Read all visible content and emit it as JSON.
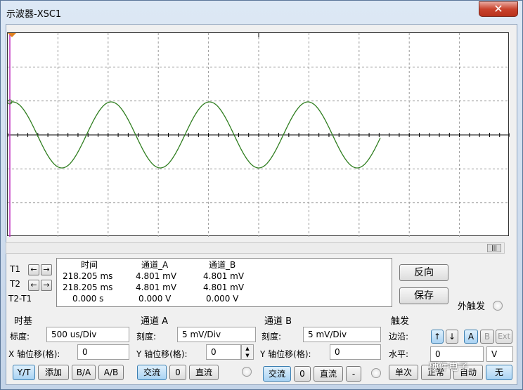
{
  "window": {
    "title": "示波器-XSC1",
    "close_glyph": "✕"
  },
  "scope": {
    "trace_color": "#2e7d1e",
    "cursor_color": "#c030c0",
    "grid_color": "#9a9a9a"
  },
  "cursors": {
    "t1_label": "T1",
    "t2_label": "T2",
    "t2t1_label": "T2-T1",
    "left_arrow": "←",
    "right_arrow": "→"
  },
  "measurements": {
    "headers": {
      "time": "时间",
      "chA": "通道_A",
      "chB": "通道_B"
    },
    "rows": [
      {
        "time": "218.205 ms",
        "chA": "4.801 mV",
        "chB": "4.801 mV"
      },
      {
        "time": "218.205 ms",
        "chA": "4.801 mV",
        "chB": "4.801 mV"
      },
      {
        "time": "0.000 s",
        "chA": "0.000 V",
        "chB": "0.000 V"
      }
    ]
  },
  "side_buttons": {
    "reverse": "反向",
    "save": "保存",
    "ext_trigger": "外触发"
  },
  "timebase": {
    "title": "时基",
    "scale_label": "标度:",
    "scale_value": "500 us/Div",
    "xpos_label": "X 轴位移(格):",
    "xpos_value": "0",
    "modes": [
      "Y/T",
      "添加",
      "B/A",
      "A/B"
    ]
  },
  "channel_a": {
    "title": "通道 A",
    "scale_label": "刻度:",
    "scale_value": "5 mV/Div",
    "ypos_label": "Y 轴位移(格):",
    "ypos_value": "0",
    "coupling": [
      "交流",
      "0",
      "直流"
    ]
  },
  "channel_b": {
    "title": "通道 B",
    "scale_label": "刻度:",
    "scale_value": "5 mV/Div",
    "ypos_label": "Y 轴位移(格):",
    "ypos_value": "0",
    "coupling": [
      "交流",
      "0",
      "直流",
      "-"
    ]
  },
  "trigger": {
    "title": "触发",
    "edge_label": "边沿:",
    "level_label": "水平:",
    "level_value": "0",
    "level_unit": "V",
    "edge_buttons": [
      "A",
      "B",
      "Ext"
    ],
    "modes": [
      "单次",
      "正常",
      "自动",
      "无"
    ]
  },
  "watermark": "硬件电子"
}
